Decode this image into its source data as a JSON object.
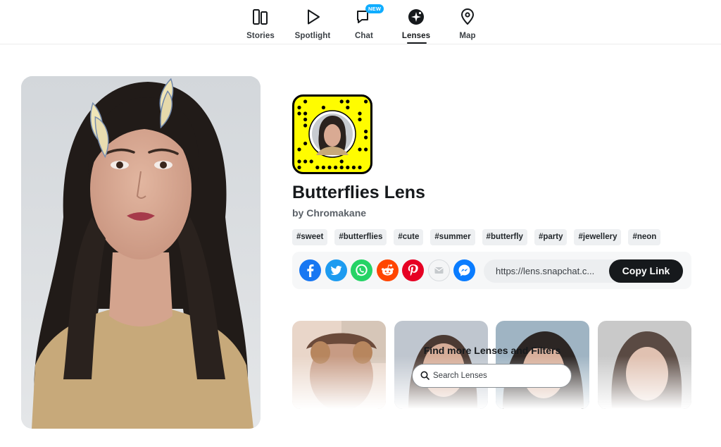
{
  "nav": {
    "items": [
      {
        "label": "Stories",
        "icon": "stories-icon"
      },
      {
        "label": "Spotlight",
        "icon": "play-icon"
      },
      {
        "label": "Chat",
        "icon": "chat-icon",
        "badge": "NEW"
      },
      {
        "label": "Lenses",
        "icon": "lenses-icon",
        "active": true
      },
      {
        "label": "Map",
        "icon": "map-pin-icon"
      }
    ]
  },
  "lens": {
    "title": "Butterflies Lens",
    "author_prefix": "by",
    "author": "Chromakane",
    "tags": [
      "#sweet",
      "#butterflies",
      "#cute",
      "#summer",
      "#butterfly",
      "#party",
      "#jewellery",
      "#neon"
    ]
  },
  "share": {
    "icons": [
      "facebook-icon",
      "twitter-icon",
      "whatsapp-icon",
      "reddit-icon",
      "pinterest-icon",
      "email-icon",
      "messenger-icon"
    ],
    "link": "https://lens.snapchat.c...",
    "copy_label": "Copy Link"
  },
  "find_more": {
    "title": "Find more Lenses and Filters",
    "search_placeholder": "Search Lenses"
  },
  "colors": {
    "snapcode_yellow": "#fffc00",
    "copy_button": "#16191c",
    "chat_badge": "#0fadff",
    "facebook": "#1877f2",
    "twitter": "#1d9bf0",
    "whatsapp": "#25d366",
    "reddit": "#ff4500",
    "pinterest": "#e60023",
    "messenger": "#0a7cff"
  }
}
